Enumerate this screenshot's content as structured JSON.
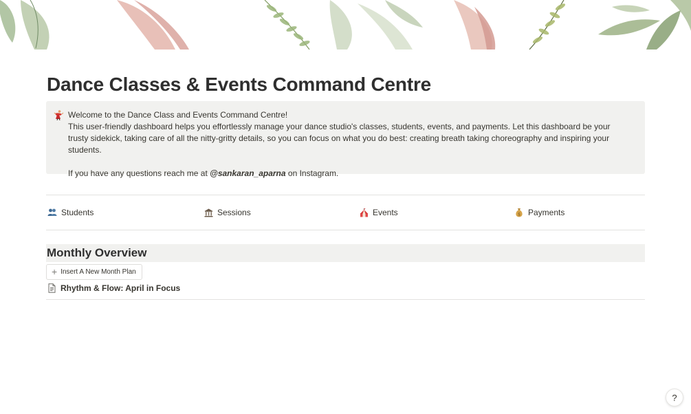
{
  "page": {
    "title": "Dance Classes & Events Command Centre"
  },
  "callout": {
    "icon": "dancer-icon",
    "line1": "Welcome to the Dance Class and Events Command Centre!",
    "line2": "This user-friendly dashboard helps you effortlessly manage your dance studio's classes, students, events, and payments. Let this dashboard be your trusty sidekick, taking care of all the nitty-gritty details, so you can focus on what you do best: creating breath taking choreography and inspiring your students.",
    "contact_prefix": "If you have any questions reach me at ",
    "contact_handle": "@sankaran_aparna",
    "contact_suffix": " on Instagram."
  },
  "nav": {
    "items": [
      {
        "label": "Students",
        "icon": "people-icon"
      },
      {
        "label": "Sessions",
        "icon": "classical-building-icon"
      },
      {
        "label": "Events",
        "icon": "circus-tent-icon"
      },
      {
        "label": "Payments",
        "icon": "money-bag-icon"
      }
    ]
  },
  "monthly": {
    "heading": "Monthly Overview",
    "button_label": "Insert A New Month Plan",
    "pages": [
      {
        "label": "Rhythm & Flow: April in Focus",
        "icon": "page-icon"
      }
    ]
  },
  "help": {
    "label": "?"
  },
  "colors": {
    "text": "#37352f",
    "callout_bg": "#f1f1ef",
    "divider": "#e3e2e0"
  }
}
